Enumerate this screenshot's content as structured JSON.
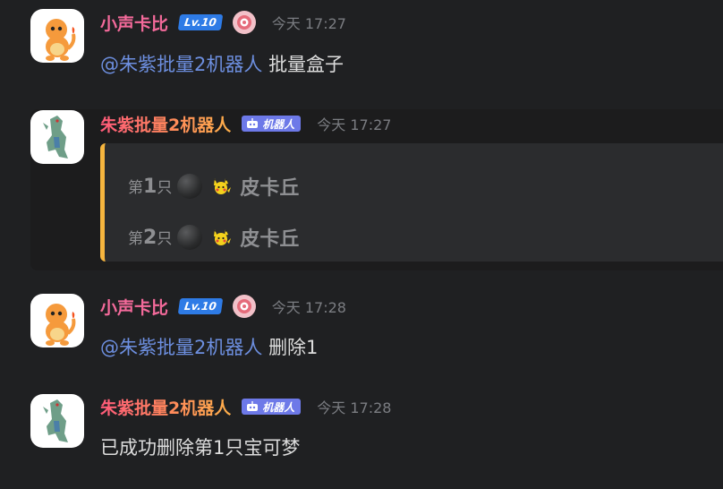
{
  "messages": [
    {
      "username": "小声卡比",
      "level_badge": "Lv.10",
      "time": "今天 17:27",
      "mention": "@朱紫批量2机器人",
      "text": "批量盒子"
    },
    {
      "username": "朱紫批量2机器人",
      "bot_badge": "机器人",
      "time": "今天 17:27",
      "embed_rows": [
        {
          "prefix": "第",
          "num": "1",
          "suffix": "只",
          "pokemon": "皮卡丘"
        },
        {
          "prefix": "第",
          "num": "2",
          "suffix": "只",
          "pokemon": "皮卡丘"
        }
      ]
    },
    {
      "username": "小声卡比",
      "level_badge": "Lv.10",
      "time": "今天 17:28",
      "mention": "@朱紫批量2机器人",
      "text": "删除1"
    },
    {
      "username": "朱紫批量2机器人",
      "bot_badge": "机器人",
      "time": "今天 17:28",
      "text": "已成功删除第1只宝可梦"
    }
  ],
  "colors": {
    "background": "#1f2022",
    "user_name": "#f46a9b",
    "mention": "#6d8fe0",
    "level_badge": "#2e7be6",
    "bot_badge": "#6d79e8",
    "embed_accent": "#f6b53e"
  },
  "icons": {
    "user_avatar": "charmander-icon",
    "bot_avatar": "tyranitar-icon",
    "medal": "medal-icon",
    "bot": "robot-icon",
    "pokeball": "pokeball-icon",
    "pikachu": "pikachu-icon"
  }
}
